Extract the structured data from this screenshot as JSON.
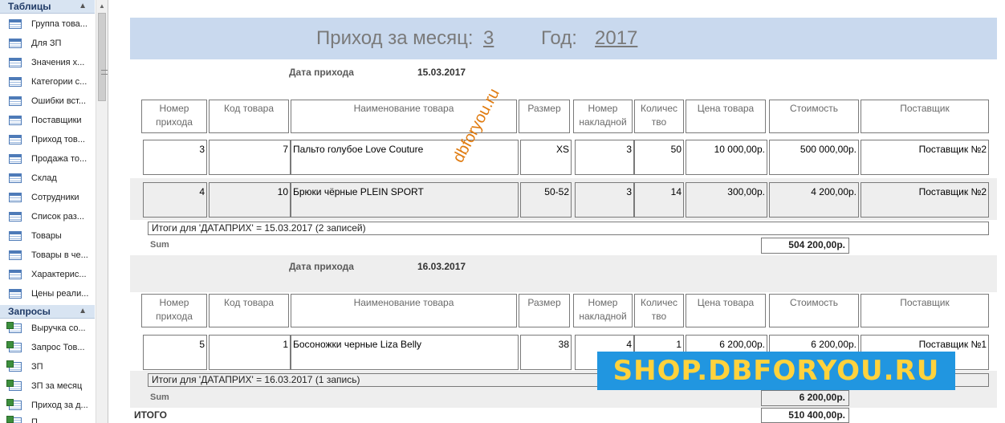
{
  "nav": {
    "tables_header": "Таблицы",
    "tables": [
      "Группа това...",
      "Для ЗП",
      "Значения х...",
      "Категории с...",
      "Ошибки вст...",
      "Поставщики",
      "Приход тов...",
      "Продажа то...",
      "Склад",
      "Сотрудники",
      "Список раз...",
      "Товары",
      "Товары в че...",
      "Характерис...",
      "Цены реали..."
    ],
    "queries_header": "Запросы",
    "queries": [
      "Выручка со...",
      "Запрос Тов...",
      "ЗП",
      "ЗП за месяц",
      "Приход за д...",
      "П..."
    ]
  },
  "report": {
    "title_prefix": "Приход за месяц:",
    "month": "3",
    "year_label": "Год:",
    "year": "2017",
    "date_label": "Дата прихода",
    "headers": [
      "Номер прихода",
      "Код товара",
      "Наименование товара",
      "Размер",
      "Номер накладной",
      "Количес тво",
      "Цена товара",
      "Стоимость",
      "Поставщик"
    ],
    "groups": [
      {
        "date": "15.03.2017",
        "rows": [
          [
            "3",
            "7",
            "Пальто голубое Love Couture",
            "XS",
            "3",
            "50",
            "10 000,00р.",
            "500 000,00р.",
            "Поставщик №2"
          ],
          [
            "4",
            "10",
            "Брюки чёрные PLEIN SPORT",
            "50-52",
            "3",
            "14",
            "300,00р.",
            "4 200,00р.",
            "Поставщик №2"
          ]
        ],
        "footer": "Итоги для 'ДАТАПРИХ' =  15.03.2017 (2 записей)",
        "sum_label": "Sum",
        "sum": "504 200,00р."
      },
      {
        "date": "16.03.2017",
        "rows": [
          [
            "5",
            "1",
            "Босоножки черные Liza Belly",
            "38",
            "4",
            "1",
            "6 200,00р.",
            "6 200,00р.",
            "Поставщик №1"
          ]
        ],
        "footer": "Итоги для 'ДАТАПРИХ' =  16.03.2017 (1 запись)",
        "sum_label": "Sum",
        "sum": "6 200,00р."
      }
    ],
    "total_label": "ИТОГО",
    "total": "510 400,00р."
  },
  "watermark": "dbforyou.ru",
  "banner": "SHOP.DBFORYOU.RU",
  "colors": {
    "title_band": "#c9d9ee",
    "nav_header": "#d8e4f2",
    "stripe": "#eeeeee",
    "banner_bg": "#2196e0",
    "banner_text": "#ffd23c",
    "watermark": "#e07b10"
  }
}
